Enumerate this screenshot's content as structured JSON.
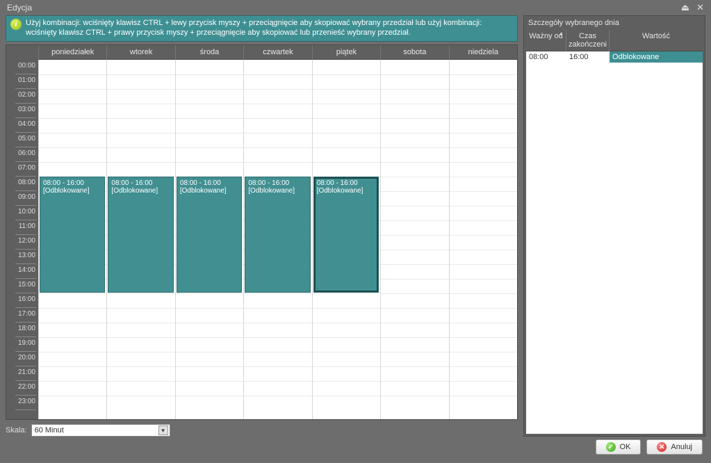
{
  "window": {
    "title": "Edycja"
  },
  "hint": {
    "text": "Użyj kombinacji: wciśnięty klawisz CTRL + lewy przycisk myszy + przeciągnięcie aby skopiować wybrany przedział lub użyj kombinacji: wciśnięty klawisz CTRL + prawy przycisk myszy + przeciągnięcie aby skopiować lub przenieść wybrany przedział."
  },
  "days": [
    "poniedziałek",
    "wtorek",
    "środa",
    "czwartek",
    "piątek",
    "sobota",
    "niedziela"
  ],
  "hours": [
    "00:00",
    "01:00",
    "02:00",
    "03:00",
    "04:00",
    "05:00",
    "06:00",
    "07:00",
    "08:00",
    "09:00",
    "10:00",
    "11:00",
    "12:00",
    "13:00",
    "14:00",
    "15:00",
    "16:00",
    "17:00",
    "18:00",
    "19:00",
    "20:00",
    "21:00",
    "22:00",
    "23:00"
  ],
  "events": [
    {
      "day": 0,
      "startRow": 8,
      "endRow": 16,
      "line1": "08:00 - 16:00",
      "line2": "[Odblokowane]",
      "selected": false
    },
    {
      "day": 1,
      "startRow": 8,
      "endRow": 16,
      "line1": "08:00 - 16:00",
      "line2": "[Odblokowane]",
      "selected": false
    },
    {
      "day": 2,
      "startRow": 8,
      "endRow": 16,
      "line1": "08:00 - 16:00",
      "line2": "[Odblokowane]",
      "selected": false
    },
    {
      "day": 3,
      "startRow": 8,
      "endRow": 16,
      "line1": "08:00 - 16:00",
      "line2": "[Odblokowane]",
      "selected": false
    },
    {
      "day": 4,
      "startRow": 8,
      "endRow": 16,
      "line1": "08:00 - 16:00",
      "line2": "[Odblokowane]",
      "selected": true
    }
  ],
  "scale": {
    "label": "Skala:",
    "value": "60 Minut"
  },
  "details": {
    "title": "Szczegóły wybranego dnia",
    "columns": {
      "c1": "Ważny od",
      "c2": "Czas zakończeni",
      "c3": "Wartość"
    },
    "rows": [
      {
        "from": "08:00",
        "to": "16:00",
        "value": "Odblokowane"
      }
    ]
  },
  "buttons": {
    "ok": "OK",
    "cancel": "Anuluj"
  }
}
